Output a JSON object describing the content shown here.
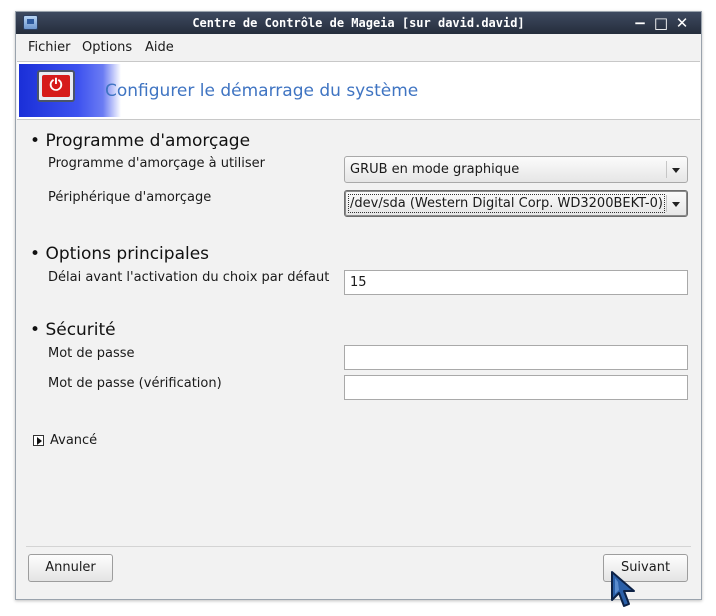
{
  "window": {
    "title": "Centre de Contrôle de Mageia  [sur david.david]",
    "controls": {
      "minimize": "−",
      "maximize": "□",
      "close": "✕"
    }
  },
  "menubar": {
    "items": [
      "Fichier",
      "Options",
      "Aide"
    ]
  },
  "banner": {
    "title": "Configurer le démarrage du système",
    "icon": "power-monitor-icon",
    "accent_color": "#1a2fd8",
    "title_color": "#3f74c2"
  },
  "sections": {
    "bootloader": {
      "title": "Programme d'amorçage",
      "fields": {
        "program": {
          "label": "Programme d'amorçage à utiliser",
          "value": "GRUB en mode graphique"
        },
        "device": {
          "label": "Périphérique d'amorçage",
          "value": "/dev/sda (Western Digital Corp. WD3200BEKT-0)"
        }
      }
    },
    "main_options": {
      "title": "Options principales",
      "fields": {
        "delay": {
          "label": "Délai avant l'activation du choix par défaut",
          "value": "15"
        }
      }
    },
    "security": {
      "title": "Sécurité",
      "fields": {
        "password": {
          "label": "Mot de passe",
          "value": ""
        },
        "password_verify": {
          "label": "Mot de passe (vérification)",
          "value": ""
        }
      }
    },
    "advanced": {
      "label": "Avancé",
      "expanded": false
    }
  },
  "buttons": {
    "cancel": "Annuler",
    "next": "Suivant"
  },
  "bullet": "•"
}
